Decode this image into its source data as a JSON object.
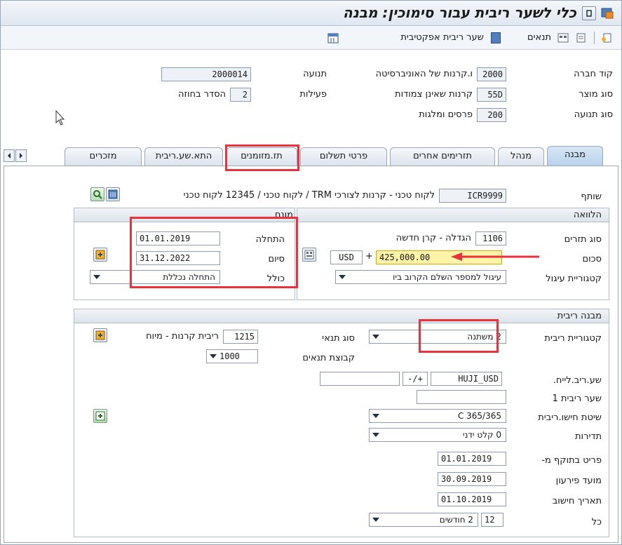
{
  "title": "כלי לשער ריבית עבור סימוכין: מבנה",
  "toolbar": {
    "conditions_label": "תנאים",
    "effective_rate_label": "שער ריבית אפקטיבית"
  },
  "header": {
    "company_code_label": "קוד חברה",
    "company_code": "2000",
    "company_name": "ו.קרנות של האוניברסיטה",
    "product_type_label": "סוג מוצר",
    "product_type": "55D",
    "product_type_text": "קרנות שאינן צמודות",
    "transaction_type_label": "סוג תנועה",
    "transaction_type": "200",
    "transaction_type_text": "פרסים ומלגות",
    "transaction_label": "תנועה",
    "transaction": "2000014",
    "activities_label": "פעילות",
    "activities": "2",
    "contract_order_label": "הסדר בחוזה"
  },
  "tabs": [
    {
      "label": "מבנה"
    },
    {
      "label": "מנהל"
    },
    {
      "label": "תזרימים אחרים"
    },
    {
      "label": "פרטי תשלום"
    },
    {
      "label": "תז.מזומנים"
    },
    {
      "label": "התא.שע.ריבית"
    },
    {
      "label": "מזכרים"
    }
  ],
  "partner": {
    "label": "שותף",
    "value": "ICR9999",
    "text": "לקוח טכני - קרנות לצורכי TRM / לקוח טכני / 12345 לקוח טכני"
  },
  "loan": {
    "title": "הלוואה",
    "flow_type_label": "סוג תזרים",
    "flow_type": "1106",
    "flow_type_text": "הגדלה - קרן חדשה",
    "amount_label": "סכום",
    "currency": "USD",
    "plus": "+",
    "amount": "425,000.00",
    "rounding_label": "קטגוריית עיגול",
    "rounding": "עיגול למספר השלם הקרוב ביו"
  },
  "term": {
    "title": "מונח",
    "start_label": "התחלה",
    "start": "01.01.2019",
    "end_label": "סיום",
    "end": "31.12.2022",
    "inclusive_label": "כולל",
    "inclusive": "התחלה נכללת"
  },
  "interest": {
    "title": "מבנה ריבית",
    "category_label": "קטגוריית ריבית",
    "category": "2 משתנה",
    "condition_type_label": "סוג תנאי",
    "condition_type": "1215",
    "condition_type_text": "ריבית קרנות - מיוח",
    "condition_group_label": "קבוצת תנאים",
    "condition_group": "1000",
    "ref_rate_label": "שע.ריב.לייח.",
    "ref_rate": "HUJI_USD",
    "plus_minus": "-/+",
    "rate1_label": "שער ריבית 1",
    "calc_method_label": "שיטת חישו.ריבית",
    "calc_method": "C 365/365",
    "frequency_label": "תדירות",
    "frequency": "0 קלט ידני",
    "effective_from_label": "פריט בתוקף מ-",
    "effective_from": "01.01.2019",
    "due_date_label": "מועד פירעון",
    "due_date": "30.09.2019",
    "calc_date_label": "תאריך חישוב",
    "calc_date": "01.10.2019",
    "every_label": "כל",
    "every_value": "12",
    "every_unit": "2 חודשים"
  },
  "colors": {
    "accent_red": "#e8323c",
    "highlight_field": "#fff3a8",
    "tab_active": "#b9d3ec"
  }
}
